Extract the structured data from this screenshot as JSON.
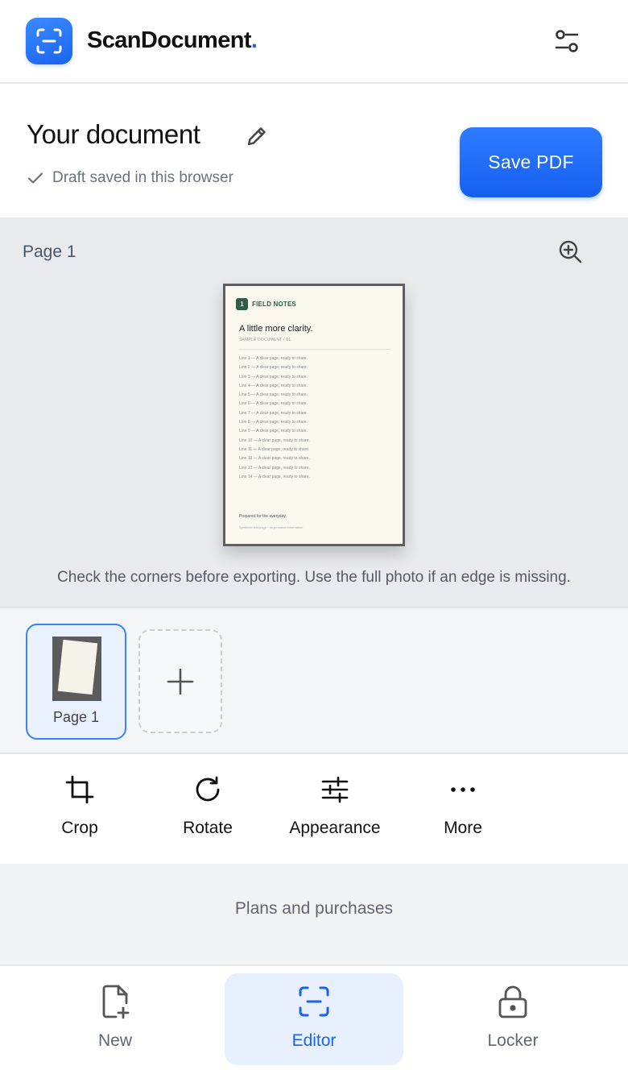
{
  "header": {
    "brand_name": "ScanDocument",
    "brand_dot": ".",
    "logo_icon": "scan-frame-icon",
    "settings_icon": "sliders-icon"
  },
  "document": {
    "title": "Your document",
    "edit_icon": "pencil-icon",
    "status": "Draft saved in this browser",
    "save_label": "Save PDF"
  },
  "preview": {
    "page_label": "Page 1",
    "zoom_icon": "zoom-in-icon",
    "hint": "Check the corners before exporting. Use the full photo if an edge is missing.",
    "paper": {
      "badge": "1",
      "brand": "FIELD NOTES",
      "heading": "A little more clarity.",
      "subheading": "SAMPLE DOCUMENT / 01",
      "lines": [
        "Line 1 — A clear page, ready to share.",
        "Line 2 — A clear page, ready to share.",
        "Line 3 — A clear page, ready to share.",
        "Line 4 — A clear page, ready to share.",
        "Line 5 — A clear page, ready to share.",
        "Line 6 — A clear page, ready to share.",
        "Line 7 — A clear page, ready to share.",
        "Line 8 — A clear page, ready to share.",
        "Line 9 — A clear page, ready to share.",
        "Line 10 — A clear page, ready to share.",
        "Line 11 — A clear page, ready to share.",
        "Line 12 — A clear page, ready to share.",
        "Line 13 — A clear page, ready to share.",
        "Line 14 — A clear page, ready to share."
      ],
      "footer_main": "Prepared for the everyday.",
      "footer_small": "Synthetic test page · no personal information"
    }
  },
  "thumbnails": {
    "pages": [
      {
        "label": "Page 1"
      }
    ],
    "add_icon": "plus-icon"
  },
  "toolbar": {
    "crop": "Crop",
    "rotate": "Rotate",
    "appearance": "Appearance",
    "more": "More"
  },
  "plans": {
    "label": "Plans and purchases"
  },
  "bottom_nav": {
    "new": "New",
    "editor": "Editor",
    "locker": "Locker"
  },
  "colors": {
    "accent": "#1a63f0",
    "preview_bg": "#e8eaee",
    "active_nav_bg": "#e8f0fd"
  }
}
